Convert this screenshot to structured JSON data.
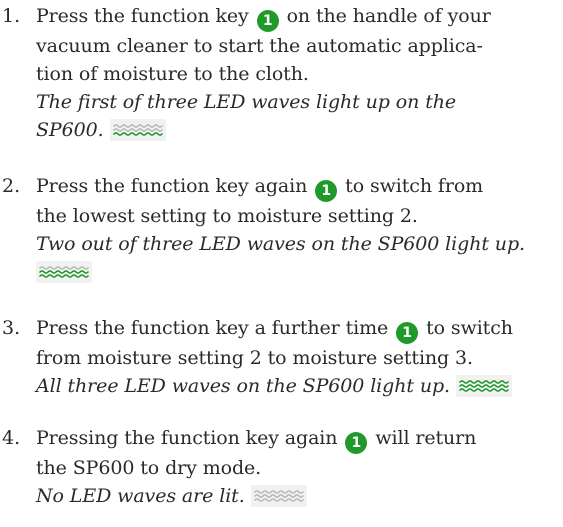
{
  "steps": [
    {
      "number": "1.",
      "lines": [
        {
          "pre": "Press the function key",
          "badge": "1",
          "post": "on the handle of your"
        },
        {
          "text": "vacuum cleaner to start the automatic applica-"
        },
        {
          "text": "tion of moisture to the cloth."
        }
      ],
      "note_lines": [
        "The first of three LED waves light up on the",
        "SP600."
      ],
      "led_level": 1
    },
    {
      "number": "2.",
      "lines": [
        {
          "pre": "Press the function key again",
          "badge": "1",
          "post": "to switch from"
        },
        {
          "text": "the lowest setting to moisture setting 2."
        }
      ],
      "note_lines": [
        "Two out of three LED waves on the SP600 light up."
      ],
      "led_level": 2
    },
    {
      "number": "3.",
      "lines": [
        {
          "pre": "Press the function key a further time",
          "badge": "1",
          "post": "to switch"
        },
        {
          "text": "from moisture setting 2 to moisture setting 3."
        }
      ],
      "note_lines": [
        "All three LED waves on the SP600 light up."
      ],
      "led_level": 3
    },
    {
      "number": "4.",
      "lines": [
        {
          "pre": "Pressing the function key again",
          "badge": "1",
          "post": "will return"
        },
        {
          "text": "the SP600 to dry mode."
        }
      ],
      "note_lines": [
        "No LED waves are lit."
      ],
      "led_level": 0
    }
  ],
  "colors": {
    "badge": "#1f9a2a",
    "wave_lit": "#1f9a2a",
    "wave_unlit": "#b9b9b9",
    "text": "#2a2a2a"
  }
}
